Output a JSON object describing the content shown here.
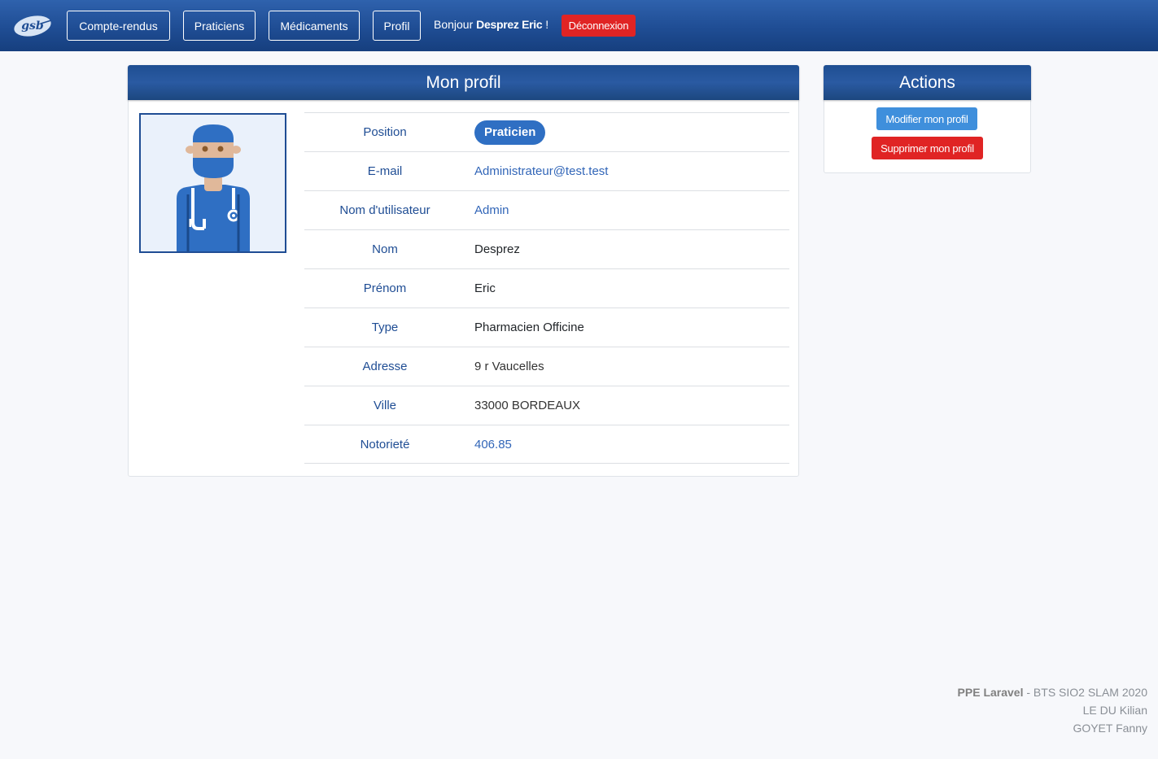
{
  "nav": {
    "logo_text": "gsb",
    "items": [
      {
        "label": "Compte-rendus"
      },
      {
        "label": "Praticiens"
      },
      {
        "label": "Médicaments"
      },
      {
        "label": "Profil"
      }
    ],
    "greeting_prefix": "Bonjour",
    "user_name": "Desprez Eric",
    "greeting_suffix": "!",
    "logout_label": "Déconnexion"
  },
  "profile": {
    "title": "Mon profil",
    "avatar_icon": "doctor-avatar-icon",
    "fields": [
      {
        "label": "Position",
        "value": "Praticien"
      },
      {
        "label": "E-mail",
        "value": "Administrateur@test.test"
      },
      {
        "label": "Nom d'utilisateur",
        "value": "Admin"
      },
      {
        "label": "Nom",
        "value": "Desprez"
      },
      {
        "label": "Prénom",
        "value": "Eric"
      },
      {
        "label": "Type",
        "value": "Pharmacien Officine"
      },
      {
        "label": "Adresse",
        "value": "9 r Vaucelles"
      },
      {
        "label": "Ville",
        "value": "33000 BORDEAUX"
      },
      {
        "label": "Notorieté",
        "value": "406.85"
      }
    ]
  },
  "actions": {
    "title": "Actions",
    "edit_label": "Modifier mon profil",
    "delete_label": "Supprimer mon profil"
  },
  "footer": {
    "project": "PPE Laravel",
    "course": " - BTS SIO2 SLAM 2020",
    "author1": "LE DU Kilian",
    "author2": "GOYET Fanny"
  },
  "colors": {
    "navbar": "#1f4d94",
    "danger": "#e02424",
    "primary": "#3f8fdc",
    "badge": "#2f6fc3"
  }
}
